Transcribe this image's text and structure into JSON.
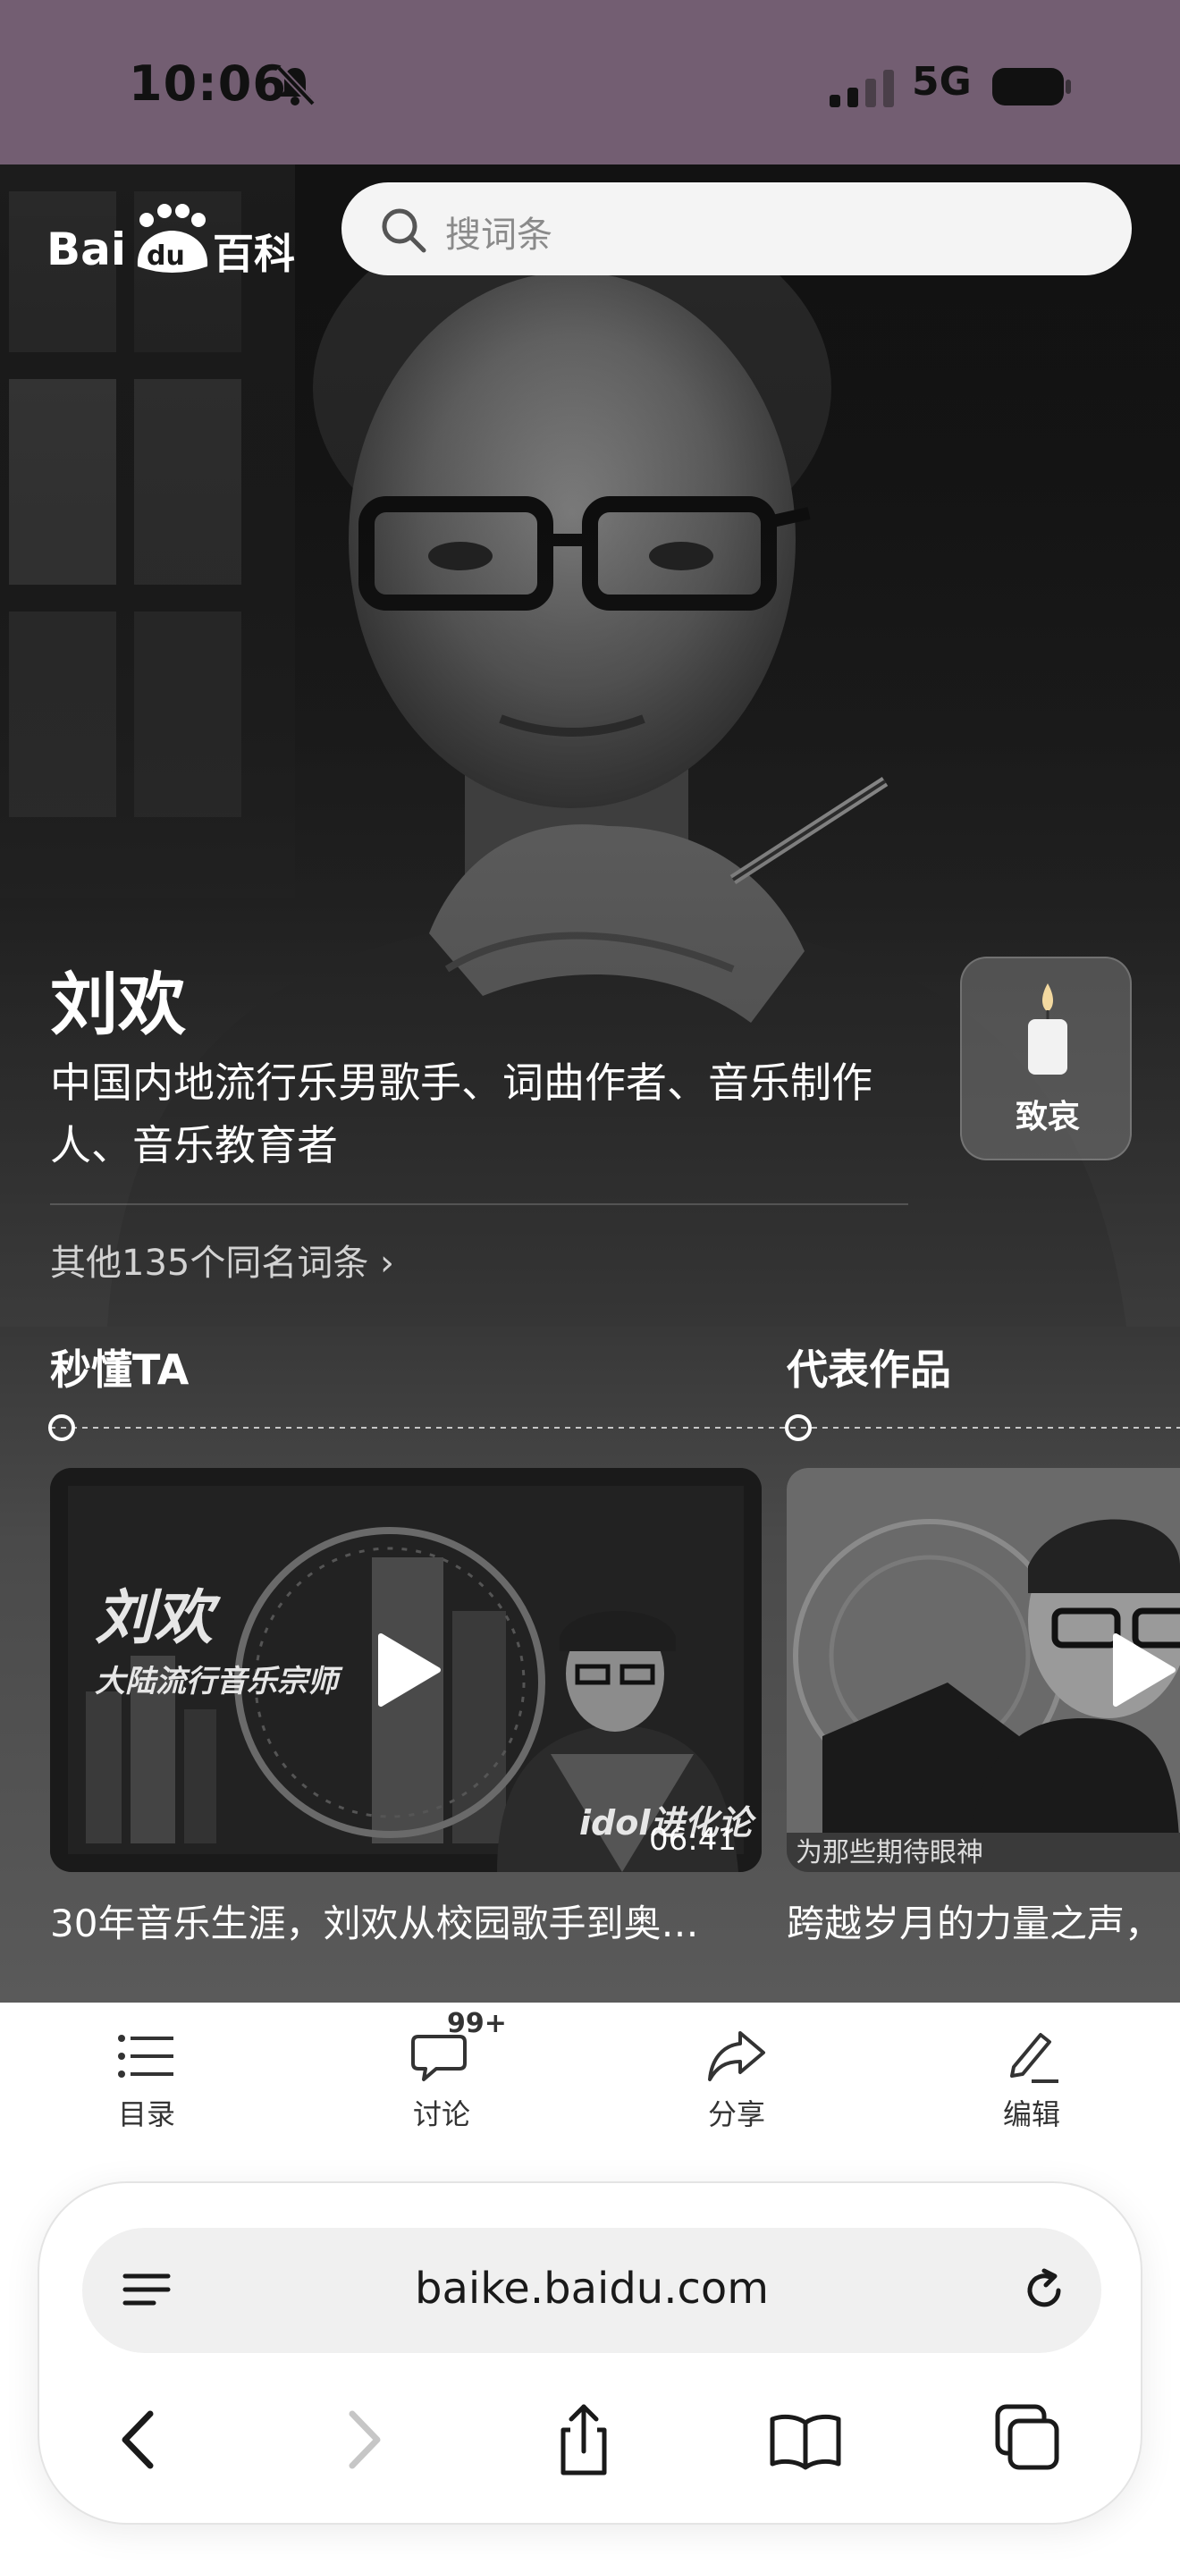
{
  "status_bar": {
    "time": "10:06",
    "network": "5G"
  },
  "header": {
    "logo_text": "Bai百科",
    "search_placeholder": "搜词条"
  },
  "entry": {
    "name": "刘欢",
    "description": "中国内地流行乐男歌手、词曲作者、音乐制作人、音乐教育者",
    "mourn_label": "致哀",
    "same_name_link": "其他135个同名词条 ›"
  },
  "sections": {
    "quick": "秒懂TA",
    "works": "代表作品"
  },
  "videos": [
    {
      "thumb_title": "刘欢",
      "thumb_subtitle": "大陆流行音乐宗师",
      "thumb_brand": "idol进化论",
      "duration": "06:41",
      "caption": "30年音乐生涯，刘欢从校园歌手到奥…"
    },
    {
      "thumb_subtitle": "为那些期待眼神",
      "caption": "跨越岁月的力量之声，"
    }
  ],
  "toolbar": [
    {
      "label": "目录",
      "icon": "list-icon"
    },
    {
      "label": "讨论",
      "icon": "comment-icon",
      "badge": "99+"
    },
    {
      "label": "分享",
      "icon": "share-icon"
    },
    {
      "label": "编辑",
      "icon": "edit-icon"
    }
  ],
  "browser": {
    "url": "baike.baidu.com"
  },
  "colors": {
    "status_bar_bg": "#735e72",
    "hero_bg": "#121212"
  }
}
